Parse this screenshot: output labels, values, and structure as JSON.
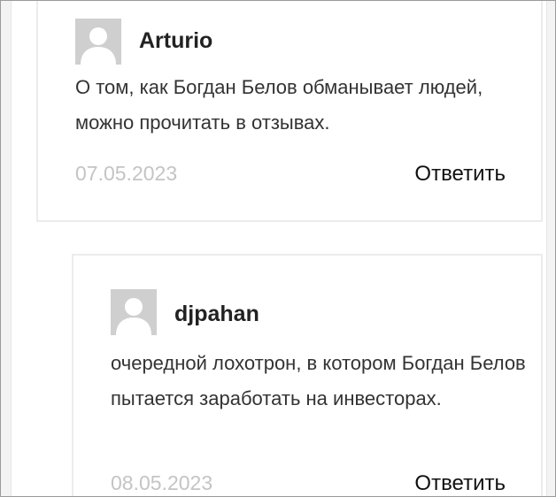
{
  "comments": [
    {
      "avatar_icon": "default-user-avatar-icon",
      "author": "Arturio",
      "text": "О том, как Богдан Белов обманывает людей, можно прочитать в отзывах.",
      "date": "07.05.2023",
      "reply_label": "Ответить"
    },
    {
      "avatar_icon": "default-user-avatar-icon",
      "author": "djpahan",
      "text": "очередной лохотрон, в котором Богдан Белов пытается заработать на инвесторах.",
      "date": "08.05.2023",
      "reply_label": "Ответить"
    }
  ],
  "colors": {
    "avatar_bg": "#cfcfcf",
    "avatar_figure": "#ffffff",
    "date_text": "#c4c4c4",
    "card_border": "#ececec"
  }
}
